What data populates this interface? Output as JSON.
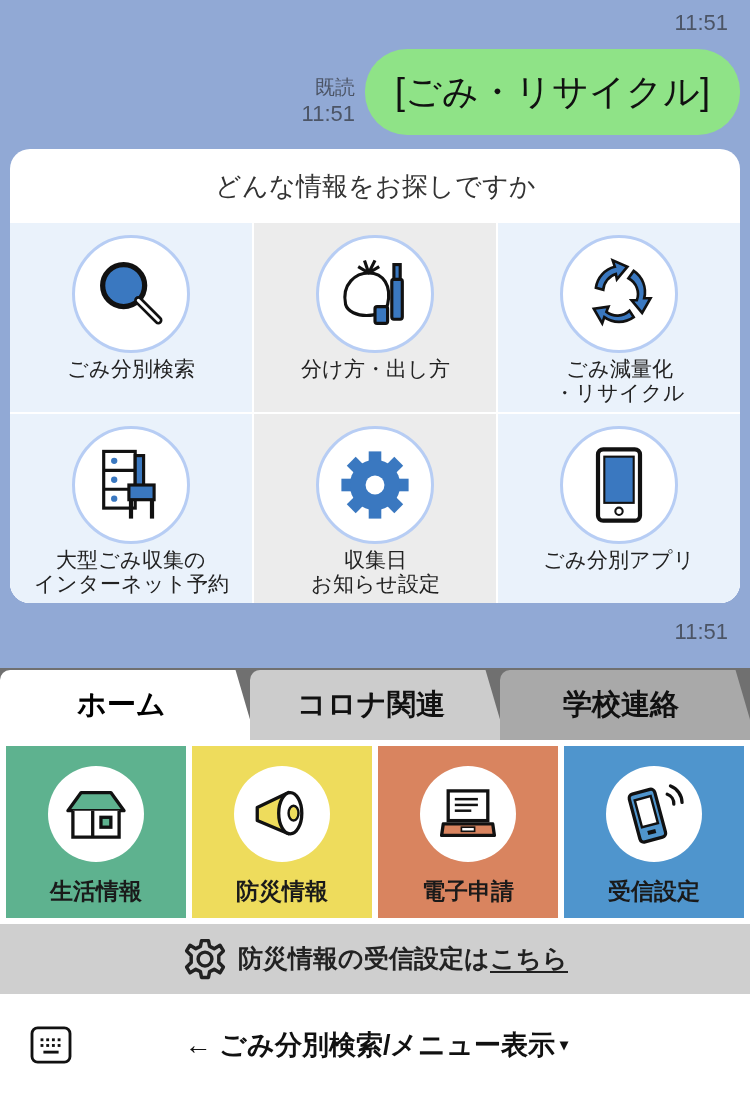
{
  "chat": {
    "top_time": "11:51",
    "message": {
      "read": "既読",
      "time": "11:51",
      "text": "[ごみ・リサイクル]"
    },
    "card": {
      "title": "どんな情報をお探しですか",
      "items": [
        {
          "kind": "search",
          "label_lines": [
            "ごみ分別検索"
          ]
        },
        {
          "kind": "trash",
          "label_lines": [
            "分け方・出し方"
          ]
        },
        {
          "kind": "recycle",
          "label_lines": [
            "ごみ減量化",
            "・リサイクル"
          ]
        },
        {
          "kind": "furniture",
          "label_lines": [
            "大型ごみ収集の",
            "インターネット予約"
          ]
        },
        {
          "kind": "gear",
          "label_lines": [
            "収集日",
            "お知らせ設定"
          ]
        },
        {
          "kind": "phone",
          "label_lines": [
            "ごみ分別アプリ"
          ]
        }
      ]
    },
    "card_time": "11:51"
  },
  "menu": {
    "tabs": [
      {
        "label": "ホーム",
        "selected": true
      },
      {
        "label": "コロナ関連",
        "selected": false
      },
      {
        "label": "学校連絡",
        "selected": false
      }
    ],
    "tiles": [
      {
        "kind": "house",
        "label": "生活情報",
        "color": "#5eb28f"
      },
      {
        "kind": "megaphone",
        "label": "防災情報",
        "color": "#eedc5c"
      },
      {
        "kind": "laptop",
        "label": "電子申請",
        "color": "#d9845f"
      },
      {
        "kind": "phone",
        "label": "受信設定",
        "color": "#4f95cd"
      }
    ],
    "banner": {
      "text": "防災情報の受信設定は",
      "link": "こちら"
    }
  },
  "bottom_bar": {
    "label": "← ごみ分別検索/メニュー表示",
    "caret": "▾"
  }
}
